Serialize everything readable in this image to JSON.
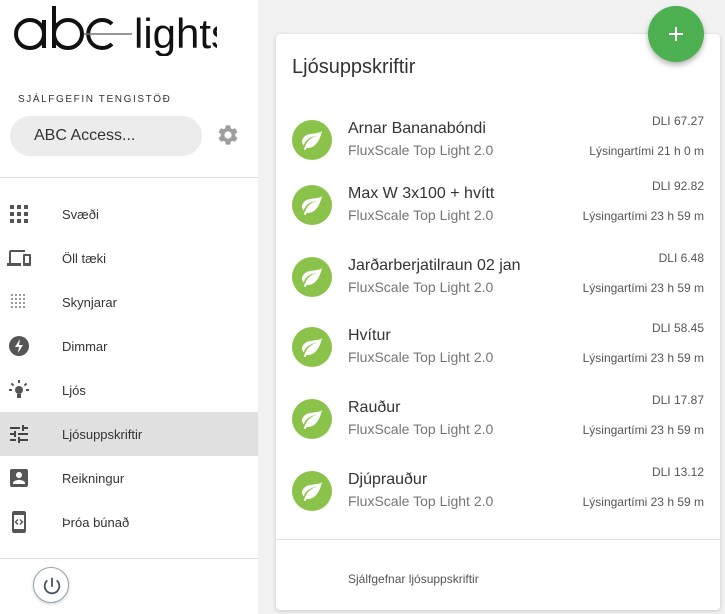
{
  "brand": {
    "logo_text": "abc lights"
  },
  "sidebar": {
    "gateway_label": "SJÁLFGEFIN TENGISTÖÐ",
    "gateway_value": "ABC Access...",
    "items": [
      {
        "label": "Svæði",
        "icon": "grid-icon"
      },
      {
        "label": "Öll tæki",
        "icon": "devices-icon"
      },
      {
        "label": "Skynjarar",
        "icon": "sensor-grid-icon"
      },
      {
        "label": "Dimmar",
        "icon": "bolt-icon"
      },
      {
        "label": "Ljós",
        "icon": "bulb-icon"
      },
      {
        "label": "Ljósuppskriftir",
        "icon": "tune-icon",
        "active": true
      },
      {
        "label": "Reikningur",
        "icon": "account-icon"
      },
      {
        "label": "Þróa búnað",
        "icon": "developer-icon"
      }
    ]
  },
  "main": {
    "title": "Ljósuppskriftir",
    "recipes": [
      {
        "name": "Arnar Bananabóndi",
        "device": "FluxScale Top Light 2.0",
        "dli": "DLI 67.27",
        "time": "Lýsingartími 21 h 0 m"
      },
      {
        "name": "Max W 3x100 + hvítt",
        "device": "FluxScale Top Light 2.0",
        "dli": "DLI 92.82",
        "time": "Lýsingartími 23 h 59 m"
      },
      {
        "name": "Jarðarberjatilraun 02 jan",
        "device": "FluxScale Top Light 2.0",
        "dli": "DLI 6.48",
        "time": "Lýsingartími 23 h 59 m"
      },
      {
        "name": "Hvítur",
        "device": "FluxScale Top Light 2.0",
        "dli": "DLI 58.45",
        "time": "Lýsingartími 23 h 59 m"
      },
      {
        "name": "Rauður",
        "device": "FluxScale Top Light 2.0",
        "dli": "DLI 17.87",
        "time": "Lýsingartími 23 h 59 m"
      },
      {
        "name": "Djúprauður",
        "device": "FluxScale Top Light 2.0",
        "dli": "DLI 13.12",
        "time": "Lýsingartími 23 h 59 m"
      }
    ],
    "default_recipes_link": "Sjálfgefnar ljósuppskriftir"
  },
  "colors": {
    "accent_green": "#4caf50",
    "leaf_green": "#8bc34a",
    "active_bg": "#e0e0e0"
  }
}
